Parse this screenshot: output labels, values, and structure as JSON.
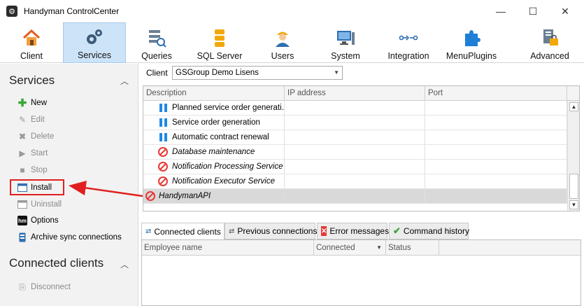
{
  "window": {
    "title": "Handyman ControlCenter",
    "minimize": "—",
    "maximize": "☐",
    "close": "✕"
  },
  "ribbon": {
    "items": [
      {
        "label": "Client",
        "icon": "house-icon"
      },
      {
        "label": "Services",
        "icon": "gears-icon",
        "active": true
      },
      {
        "label": "Queries",
        "icon": "query-icon"
      },
      {
        "label": "SQL Server",
        "icon": "database-icon"
      },
      {
        "label": "Users",
        "icon": "user-icon"
      },
      {
        "label": "System",
        "icon": "computer-icon"
      },
      {
        "label": "Integration",
        "icon": "integration-icon"
      },
      {
        "label": "MenuPlugins",
        "icon": "puzzle-icon"
      },
      {
        "label": "Advanced",
        "icon": "advanced-icon"
      }
    ]
  },
  "sidebar": {
    "services_title": "Services",
    "actions": [
      {
        "label": "New",
        "enabled": true,
        "icon": "plus-icon"
      },
      {
        "label": "Edit",
        "enabled": false,
        "icon": "edit-icon"
      },
      {
        "label": "Delete",
        "enabled": false,
        "icon": "delete-icon"
      },
      {
        "label": "Start",
        "enabled": false,
        "icon": "play-icon"
      },
      {
        "label": "Stop",
        "enabled": false,
        "icon": "stop-icon"
      },
      {
        "label": "Install",
        "enabled": true,
        "icon": "install-icon"
      },
      {
        "label": "Uninstall",
        "enabled": false,
        "icon": "uninstall-icon"
      },
      {
        "label": "Options",
        "enabled": true,
        "icon": "hm-icon"
      },
      {
        "label": "Archive sync connections",
        "enabled": true,
        "icon": "archive-icon"
      }
    ],
    "hm_badge": "hm",
    "connected_title": "Connected clients",
    "disconnect_label": "Disconnect"
  },
  "client": {
    "label": "Client",
    "value": "GSGroup Demo Lisens"
  },
  "services_grid": {
    "columns": [
      "Description",
      "IP address",
      "Port"
    ],
    "rows": [
      {
        "desc": "Planned service order generati...",
        "status": "running",
        "italic": false
      },
      {
        "desc": "Service order generation",
        "status": "running",
        "italic": false
      },
      {
        "desc": "Automatic contract renewal",
        "status": "running",
        "italic": false
      },
      {
        "desc": "Database maintenance",
        "status": "not-installed",
        "italic": true
      },
      {
        "desc": "Notification Processing Service",
        "status": "not-installed",
        "italic": true
      },
      {
        "desc": "Notification Executor Service",
        "status": "not-installed",
        "italic": true
      },
      {
        "desc": "HandymanAPI",
        "status": "not-installed",
        "italic": true,
        "selected": true
      }
    ]
  },
  "bottom_tabs": [
    {
      "label": "Connected clients",
      "icon": "connected-icon",
      "active": true
    },
    {
      "label": "Previous connections",
      "icon": "history-connections-icon"
    },
    {
      "label": "Error messages",
      "icon": "error-icon"
    },
    {
      "label": "Command history",
      "icon": "check-icon"
    }
  ],
  "clients_grid": {
    "columns": [
      "Employee name",
      "Connected",
      "Status"
    ]
  },
  "colors": {
    "accent": "#cde3f7",
    "annotation": "#e02020",
    "running": "#1e88e5",
    "stopped": "#e53935"
  }
}
